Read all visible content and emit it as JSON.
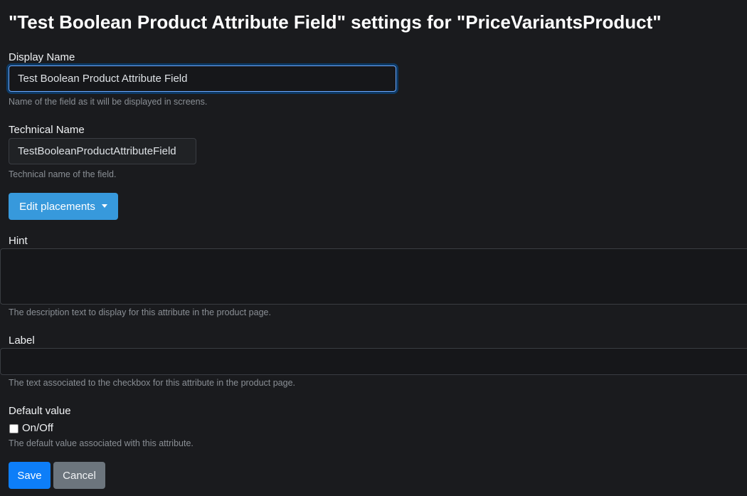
{
  "title": "\"Test Boolean Product Attribute Field\" settings for \"PriceVariantsProduct\"",
  "display_name": {
    "label": "Display Name",
    "value": "Test Boolean Product Attribute Field",
    "help": "Name of the field as it will be displayed in screens."
  },
  "technical_name": {
    "label": "Technical Name",
    "value": "TestBooleanProductAttributeField",
    "help": "Technical name of the field."
  },
  "edit_placements_label": "Edit placements",
  "hint": {
    "label": "Hint",
    "value": "",
    "help": "The description text to display for this attribute in the product page."
  },
  "label_field": {
    "label": "Label",
    "value": "",
    "help": "The text associated to the checkbox for this attribute in the product page."
  },
  "default_value": {
    "label": "Default value",
    "checkbox_label": "On/Off",
    "checked": false,
    "help": "The default value associated with this attribute."
  },
  "save_label": "Save",
  "cancel_label": "Cancel",
  "colors": {
    "primary": "#0d7ef8",
    "info": "#3799dc",
    "secondary": "#6c757d",
    "background": "#1a1b1e"
  }
}
